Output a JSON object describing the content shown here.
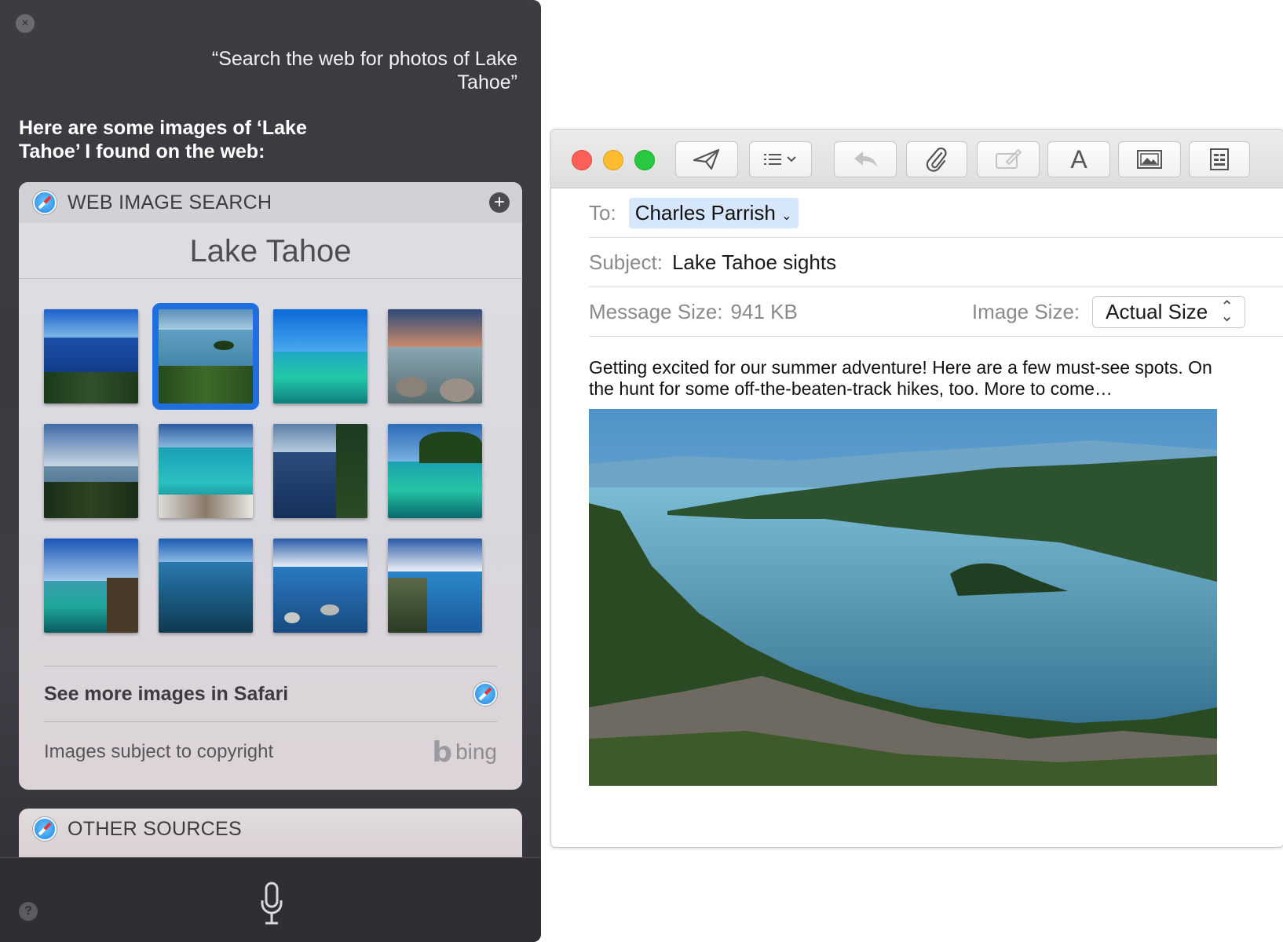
{
  "siri": {
    "close_icon": "close-icon",
    "query": "“Search the web for photos of Lake Tahoe”",
    "answer": "Here are some images of ‘Lake Tahoe’ I found on the web:",
    "web_card": {
      "header": "WEB IMAGE SEARCH",
      "title": "Lake Tahoe",
      "selected_index": 1,
      "thumbnail_count": 12,
      "see_more": "See more images in Safari",
      "copyright": "Images subject to copyright",
      "bing": "bing"
    },
    "other_card": {
      "header": "OTHER SOURCES"
    },
    "help_label": "?"
  },
  "mail": {
    "to_label": "To:",
    "to_value": "Charles Parrish",
    "subject_label": "Subject:",
    "subject_value": "Lake Tahoe sights",
    "message_size_label": "Message Size:",
    "message_size_value": "941 KB",
    "image_size_label": "Image Size:",
    "image_size_value": "Actual Size",
    "body": "Getting excited for our summer adventure! Here are a few must-see spots. On the hunt for some off-the-beaten-track hikes, too. More to come…",
    "toolbar": {
      "font_label": "A"
    }
  },
  "colors": {
    "selection": "#1f6fde",
    "traffic_red": "#fc5f57",
    "traffic_yellow": "#fdbc2e",
    "traffic_green": "#28c840",
    "recipient_token": "#d6e6fb"
  }
}
